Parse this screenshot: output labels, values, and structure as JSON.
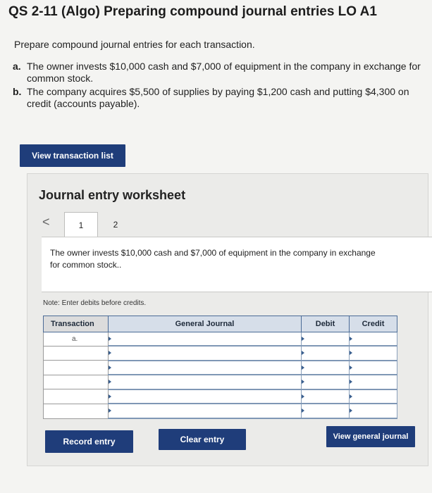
{
  "header": {
    "title": "QS 2-11 (Algo) Preparing compound journal entries LO A1"
  },
  "instructions": "Prepare compound journal entries for each transaction.",
  "transactions": [
    {
      "letter": "a.",
      "text": "The owner invests $10,000 cash and $7,000 of equipment in the company in exchange for common stock."
    },
    {
      "letter": "b.",
      "text": "The company acquires $5,500 of supplies by paying $1,200 cash and putting $4,300 on credit (accounts payable)."
    }
  ],
  "buttons": {
    "view_transaction_list": "View transaction list",
    "record_entry": "Record entry",
    "clear_entry": "Clear entry",
    "view_general_journal": "View general journal"
  },
  "worksheet": {
    "title": "Journal entry worksheet",
    "prev_arrow": "<",
    "tabs": [
      "1",
      "2"
    ],
    "active_tab": "1",
    "description": "The owner invests $10,000 cash and $7,000 of equipment in the company in exchange for common stock..",
    "note": "Note: Enter debits before credits."
  },
  "journal_table": {
    "headers": {
      "transaction": "Transaction",
      "general_journal": "General Journal",
      "debit": "Debit",
      "credit": "Credit"
    },
    "rows": [
      {
        "transaction": "a.",
        "account": "",
        "debit": "",
        "credit": ""
      },
      {
        "transaction": "",
        "account": "",
        "debit": "",
        "credit": ""
      },
      {
        "transaction": "",
        "account": "",
        "debit": "",
        "credit": ""
      },
      {
        "transaction": "",
        "account": "",
        "debit": "",
        "credit": ""
      },
      {
        "transaction": "",
        "account": "",
        "debit": "",
        "credit": ""
      },
      {
        "transaction": "",
        "account": "",
        "debit": "",
        "credit": ""
      }
    ]
  },
  "colors": {
    "button_bg": "#1f3d7a",
    "table_border": "#4b6b96",
    "page_bg": "#f4f4f2"
  }
}
